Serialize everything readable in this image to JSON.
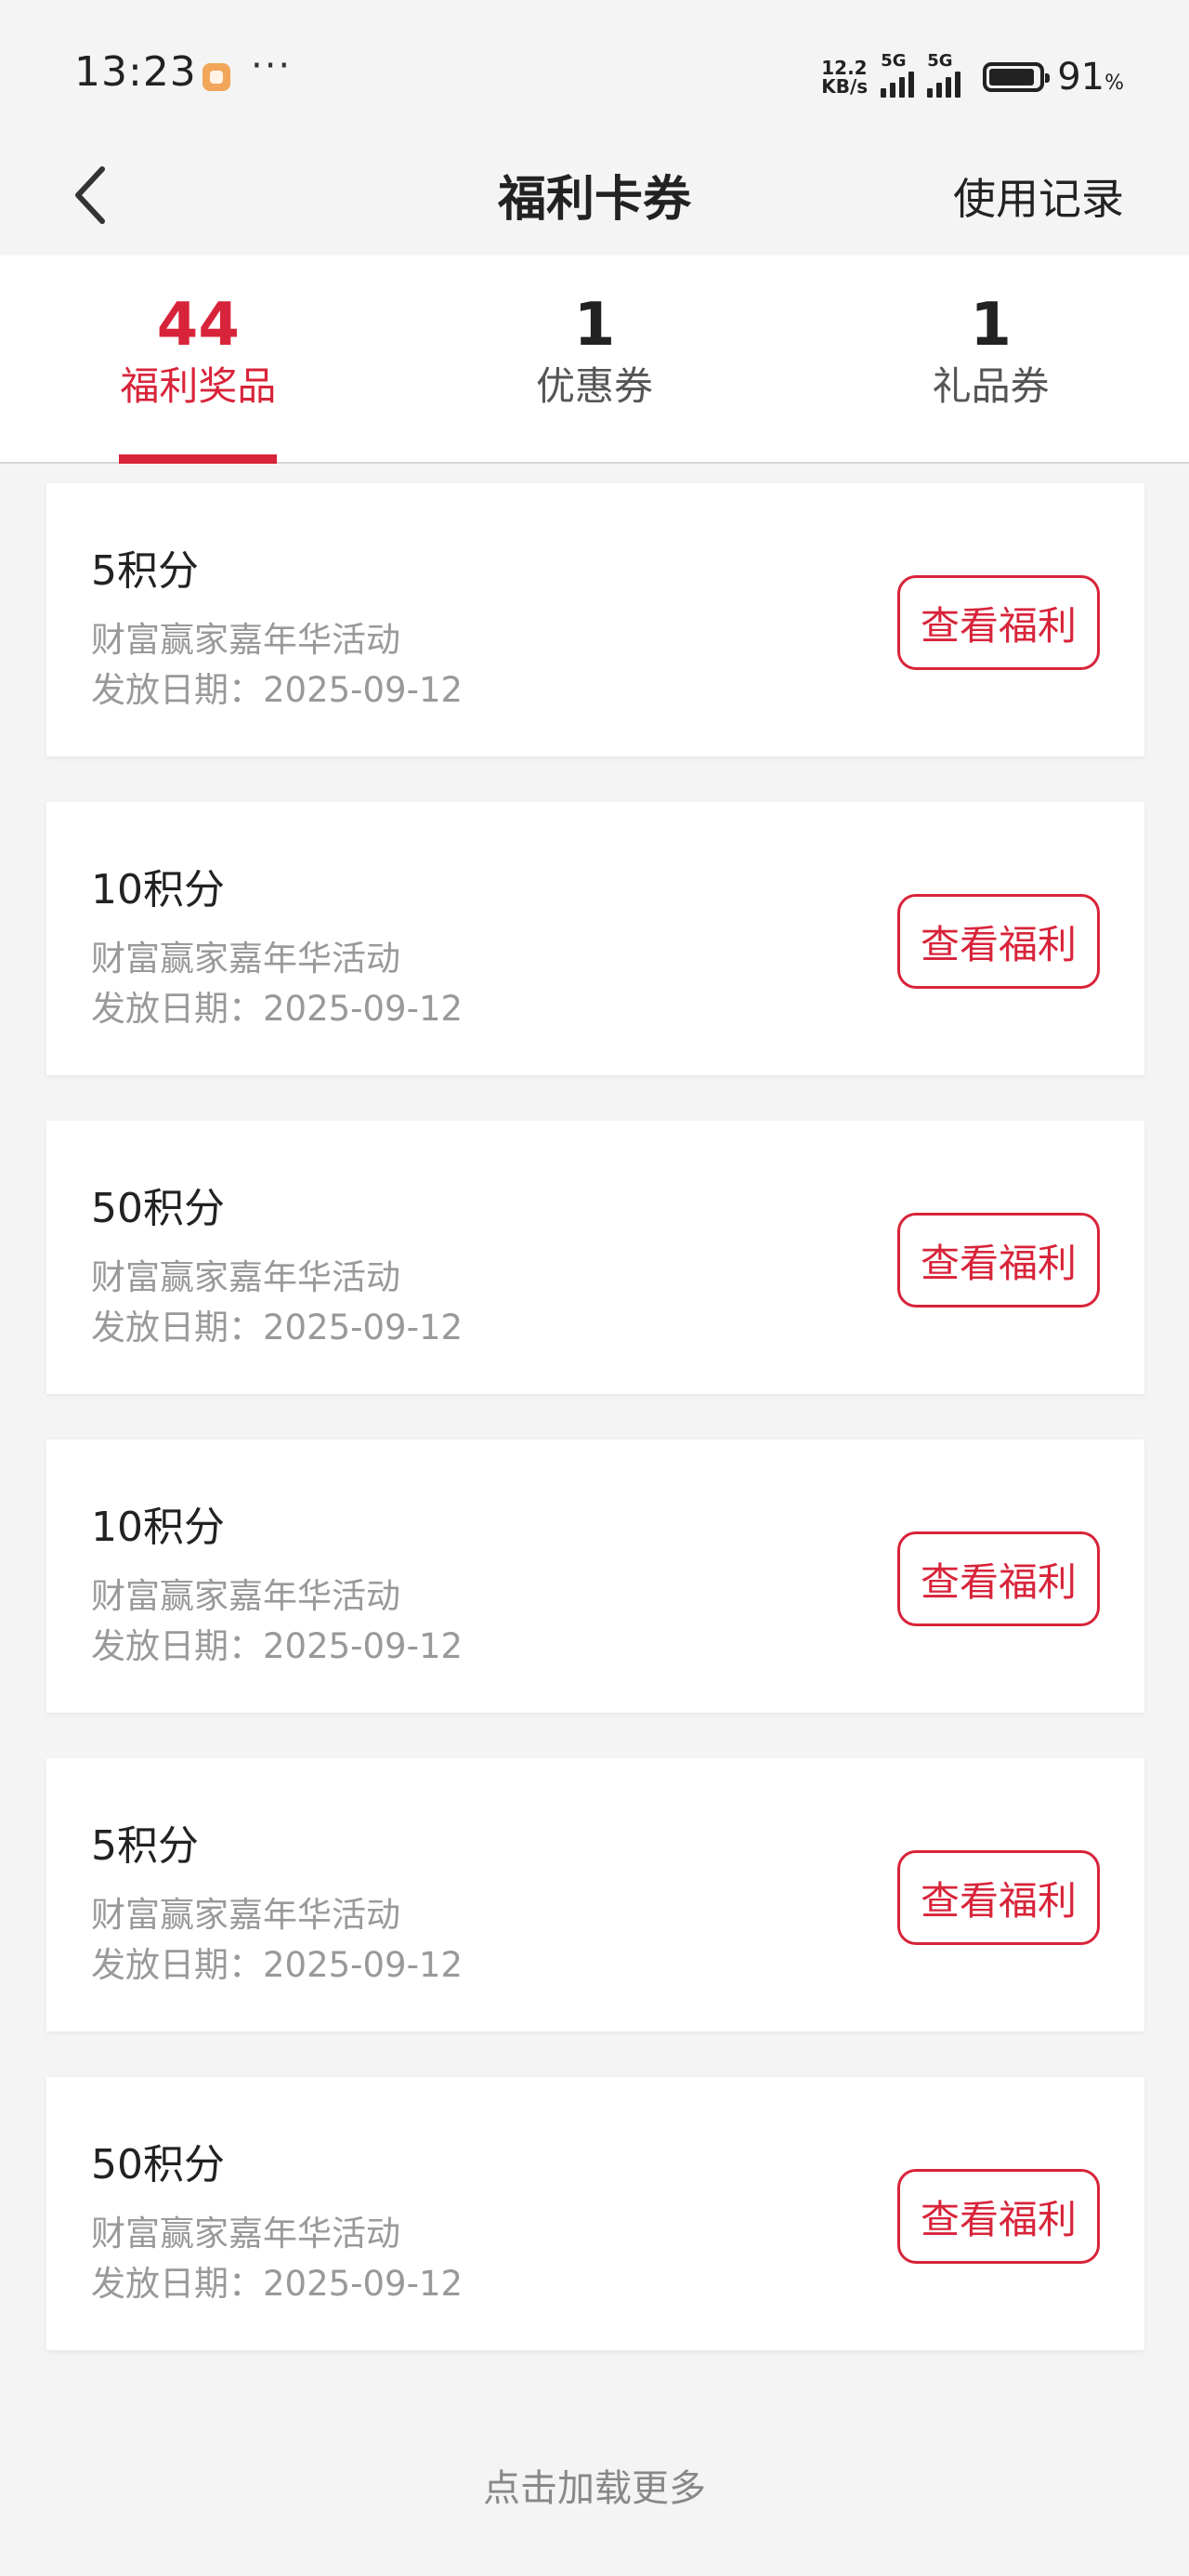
{
  "status_bar": {
    "time": "13:23",
    "more": "···",
    "net_speed_value": "12.2",
    "net_speed_unit": "KB/s",
    "signal1_tag": "5G",
    "signal2_tag": "5G",
    "battery_level": 0.91,
    "battery_percent": "91",
    "battery_unit": "%"
  },
  "header": {
    "title": "福利卡券",
    "right_action": "使用记录",
    "back_icon": "chevron-left-icon"
  },
  "tabs": [
    {
      "count": "44",
      "label": "福利奖品",
      "active": true
    },
    {
      "count": "1",
      "label": "优惠券",
      "active": false
    },
    {
      "count": "1",
      "label": "礼品券",
      "active": false
    }
  ],
  "cards": [
    {
      "title": "5积分",
      "event": "财富赢家嘉年华活动",
      "date": "发放日期：2025-09-12",
      "button": "查看福利"
    },
    {
      "title": "10积分",
      "event": "财富赢家嘉年华活动",
      "date": "发放日期：2025-09-12",
      "button": "查看福利"
    },
    {
      "title": "50积分",
      "event": "财富赢家嘉年华活动",
      "date": "发放日期：2025-09-12",
      "button": "查看福利"
    },
    {
      "title": "10积分",
      "event": "财富赢家嘉年华活动",
      "date": "发放日期：2025-09-12",
      "button": "查看福利"
    },
    {
      "title": "5积分",
      "event": "财富赢家嘉年华活动",
      "date": "发放日期：2025-09-12",
      "button": "查看福利"
    },
    {
      "title": "50积分",
      "event": "财富赢家嘉年华活动",
      "date": "发放日期：2025-09-12",
      "button": "查看福利"
    }
  ],
  "footer": {
    "load_more": "点击加载更多"
  },
  "colors": {
    "accent": "#d8243a",
    "page_bg": "#f4f4f4",
    "muted_text": "#999999"
  }
}
